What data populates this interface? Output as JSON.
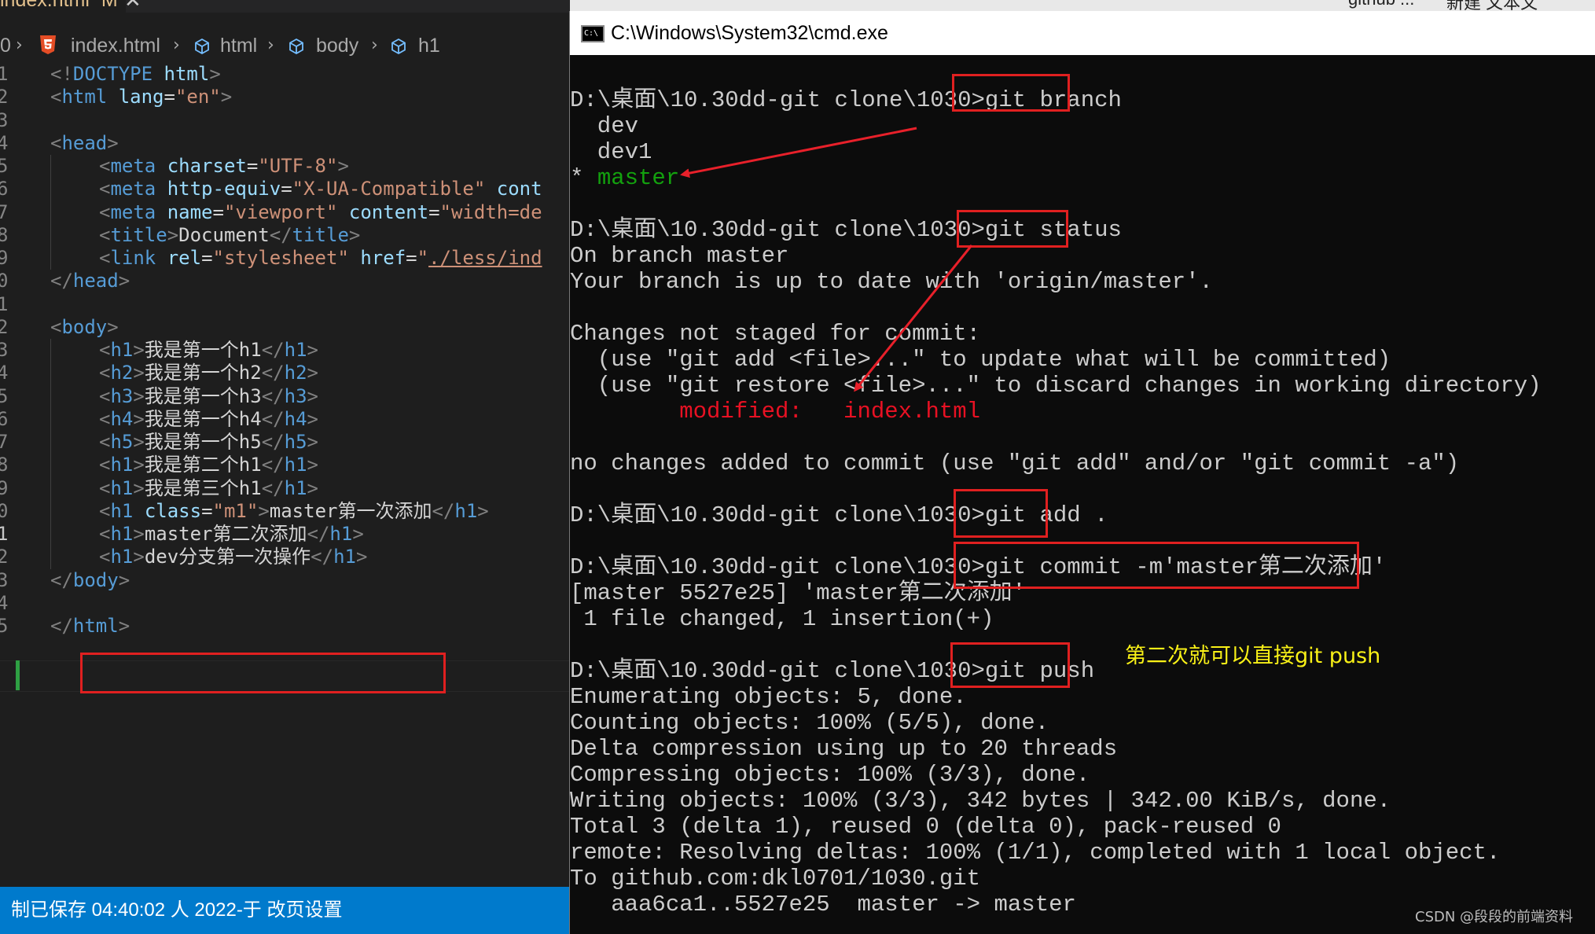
{
  "editor": {
    "tab": {
      "filename": "index.html",
      "status": "M",
      "close": "✕"
    },
    "breadcrumb": {
      "prefix": "0",
      "file": "index.html",
      "items": [
        "html",
        "body",
        "h1"
      ]
    },
    "lines": [
      {
        "n": "1",
        "tokens": [
          [
            "t",
            "<!"
          ],
          [
            "tg",
            "DOCTYPE"
          ],
          [
            "tx",
            " "
          ],
          [
            "at",
            "html"
          ],
          [
            "t",
            ">"
          ]
        ],
        "indent": 0
      },
      {
        "n": "2",
        "tokens": [
          [
            "t",
            "<"
          ],
          [
            "tg",
            "html"
          ],
          [
            "tx",
            " "
          ],
          [
            "at",
            "lang"
          ],
          [
            "tx",
            "="
          ],
          [
            "st",
            "\"en\""
          ],
          [
            "t",
            ">"
          ]
        ],
        "indent": 0
      },
      {
        "n": "3",
        "tokens": [],
        "indent": 0
      },
      {
        "n": "4",
        "tokens": [
          [
            "t",
            "<"
          ],
          [
            "tg",
            "head"
          ],
          [
            "t",
            ">"
          ]
        ],
        "indent": 0
      },
      {
        "n": "5",
        "tokens": [
          [
            "t",
            "<"
          ],
          [
            "tg",
            "meta"
          ],
          [
            "tx",
            " "
          ],
          [
            "at",
            "charset"
          ],
          [
            "tx",
            "="
          ],
          [
            "st",
            "\"UTF-8\""
          ],
          [
            "t",
            ">"
          ]
        ],
        "indent": 1
      },
      {
        "n": "6",
        "tokens": [
          [
            "t",
            "<"
          ],
          [
            "tg",
            "meta"
          ],
          [
            "tx",
            " "
          ],
          [
            "at",
            "http-equiv"
          ],
          [
            "tx",
            "="
          ],
          [
            "st",
            "\"X-UA-Compatible\""
          ],
          [
            "tx",
            " "
          ],
          [
            "at",
            "cont"
          ]
        ],
        "indent": 1
      },
      {
        "n": "7",
        "tokens": [
          [
            "t",
            "<"
          ],
          [
            "tg",
            "meta"
          ],
          [
            "tx",
            " "
          ],
          [
            "at",
            "name"
          ],
          [
            "tx",
            "="
          ],
          [
            "st",
            "\"viewport\""
          ],
          [
            "tx",
            " "
          ],
          [
            "at",
            "content"
          ],
          [
            "tx",
            "="
          ],
          [
            "st",
            "\"width=de"
          ]
        ],
        "indent": 1
      },
      {
        "n": "8",
        "tokens": [
          [
            "t",
            "<"
          ],
          [
            "tg",
            "title"
          ],
          [
            "t",
            ">"
          ],
          [
            "tx",
            "Document"
          ],
          [
            "t",
            "</"
          ],
          [
            "tg",
            "title"
          ],
          [
            "t",
            ">"
          ]
        ],
        "indent": 1
      },
      {
        "n": "9",
        "tokens": [
          [
            "t",
            "<"
          ],
          [
            "tg",
            "link"
          ],
          [
            "tx",
            " "
          ],
          [
            "at",
            "rel"
          ],
          [
            "tx",
            "="
          ],
          [
            "st",
            "\"stylesheet\""
          ],
          [
            "tx",
            " "
          ],
          [
            "at",
            "href"
          ],
          [
            "tx",
            "="
          ],
          [
            "st",
            "\""
          ],
          [
            "stl",
            "./less/ind"
          ]
        ],
        "indent": 1
      },
      {
        "n": "0",
        "tokens": [
          [
            "t",
            "</"
          ],
          [
            "tg",
            "head"
          ],
          [
            "t",
            ">"
          ]
        ],
        "indent": 0
      },
      {
        "n": "1",
        "tokens": [],
        "indent": 0
      },
      {
        "n": "2",
        "tokens": [
          [
            "t",
            "<"
          ],
          [
            "tg",
            "body"
          ],
          [
            "t",
            ">"
          ]
        ],
        "indent": 0
      },
      {
        "n": "3",
        "tokens": [
          [
            "t",
            "<"
          ],
          [
            "tg",
            "h1"
          ],
          [
            "t",
            ">"
          ],
          [
            "tx",
            "我是第一个h1"
          ],
          [
            "t",
            "</"
          ],
          [
            "tg",
            "h1"
          ],
          [
            "t",
            ">"
          ]
        ],
        "indent": 1
      },
      {
        "n": "4",
        "tokens": [
          [
            "t",
            "<"
          ],
          [
            "tg",
            "h2"
          ],
          [
            "t",
            ">"
          ],
          [
            "tx",
            "我是第一个h2"
          ],
          [
            "t",
            "</"
          ],
          [
            "tg",
            "h2"
          ],
          [
            "t",
            ">"
          ]
        ],
        "indent": 1
      },
      {
        "n": "5",
        "tokens": [
          [
            "t",
            "<"
          ],
          [
            "tg",
            "h3"
          ],
          [
            "t",
            ">"
          ],
          [
            "tx",
            "我是第一个h3"
          ],
          [
            "t",
            "</"
          ],
          [
            "tg",
            "h3"
          ],
          [
            "t",
            ">"
          ]
        ],
        "indent": 1
      },
      {
        "n": "6",
        "tokens": [
          [
            "t",
            "<"
          ],
          [
            "tg",
            "h4"
          ],
          [
            "t",
            ">"
          ],
          [
            "tx",
            "我是第一个h4"
          ],
          [
            "t",
            "</"
          ],
          [
            "tg",
            "h4"
          ],
          [
            "t",
            ">"
          ]
        ],
        "indent": 1
      },
      {
        "n": "7",
        "tokens": [
          [
            "t",
            "<"
          ],
          [
            "tg",
            "h5"
          ],
          [
            "t",
            ">"
          ],
          [
            "tx",
            "我是第一个h5"
          ],
          [
            "t",
            "</"
          ],
          [
            "tg",
            "h5"
          ],
          [
            "t",
            ">"
          ]
        ],
        "indent": 1
      },
      {
        "n": "8",
        "tokens": [
          [
            "t",
            "<"
          ],
          [
            "tg",
            "h1"
          ],
          [
            "t",
            ">"
          ],
          [
            "tx",
            "我是第二个h1"
          ],
          [
            "t",
            "</"
          ],
          [
            "tg",
            "h1"
          ],
          [
            "t",
            ">"
          ]
        ],
        "indent": 1
      },
      {
        "n": "9",
        "tokens": [
          [
            "t",
            "<"
          ],
          [
            "tg",
            "h1"
          ],
          [
            "t",
            ">"
          ],
          [
            "tx",
            "我是第三个h1"
          ],
          [
            "t",
            "</"
          ],
          [
            "tg",
            "h1"
          ],
          [
            "t",
            ">"
          ]
        ],
        "indent": 1
      },
      {
        "n": "0",
        "tokens": [
          [
            "t",
            "<"
          ],
          [
            "tg",
            "h1"
          ],
          [
            "tx",
            " "
          ],
          [
            "at",
            "class"
          ],
          [
            "tx",
            "="
          ],
          [
            "st",
            "\"m1\""
          ],
          [
            "t",
            ">"
          ],
          [
            "tx",
            "master第一次添加"
          ],
          [
            "t",
            "</"
          ],
          [
            "tg",
            "h1"
          ],
          [
            "t",
            ">"
          ]
        ],
        "indent": 1
      },
      {
        "n": "1",
        "tokens": [
          [
            "t",
            "<"
          ],
          [
            "tg",
            "h1"
          ],
          [
            "t",
            ">"
          ],
          [
            "tx",
            "master第二次添加"
          ],
          [
            "t",
            "</"
          ],
          [
            "tg",
            "h1"
          ],
          [
            "t",
            ">"
          ]
        ],
        "indent": 1,
        "active": true
      },
      {
        "n": "2",
        "tokens": [
          [
            "t",
            "<"
          ],
          [
            "tg",
            "h1"
          ],
          [
            "t",
            ">"
          ],
          [
            "tx",
            "dev分支第一次操作"
          ],
          [
            "t",
            "</"
          ],
          [
            "tg",
            "h1"
          ],
          [
            "t",
            ">"
          ]
        ],
        "indent": 1
      },
      {
        "n": "3",
        "tokens": [
          [
            "t",
            "</"
          ],
          [
            "tg",
            "body"
          ],
          [
            "t",
            ">"
          ]
        ],
        "indent": 0
      },
      {
        "n": "4",
        "tokens": [],
        "indent": 0
      },
      {
        "n": "5",
        "tokens": [
          [
            "t",
            "</"
          ],
          [
            "tg",
            "html"
          ],
          [
            "t",
            ">"
          ]
        ],
        "indent": 0
      }
    ],
    "statusbar": "制已保存 04:40:02     人 2022-于     改页设置"
  },
  "behind": {
    "text1": "github ...",
    "text2": "新建 文本文"
  },
  "cmd": {
    "title": "C:\\Windows\\System32\\cmd.exe",
    "icon_label": "C:\\",
    "lines": [
      {
        "text": "",
        "color": "default"
      },
      {
        "text": "D:\\桌面\\10.30dd-git clone\\1030>git branch",
        "color": "default"
      },
      {
        "text": "  dev",
        "color": "default"
      },
      {
        "text": "  dev1",
        "color": "default"
      },
      {
        "text": "* master",
        "color": "star-green"
      },
      {
        "text": "",
        "color": "default"
      },
      {
        "text": "D:\\桌面\\10.30dd-git clone\\1030>git status",
        "color": "default"
      },
      {
        "text": "On branch master",
        "color": "default"
      },
      {
        "text": "Your branch is up to date with 'origin/master'.",
        "color": "default"
      },
      {
        "text": "",
        "color": "default"
      },
      {
        "text": "Changes not staged for commit:",
        "color": "default"
      },
      {
        "text": "  (use \"git add <file>...\" to update what will be committed)",
        "color": "default"
      },
      {
        "text": "  (use \"git restore <file>...\" to discard changes in working directory)",
        "color": "default"
      },
      {
        "text": "        modified:   index.html",
        "color": "red"
      },
      {
        "text": "",
        "color": "default"
      },
      {
        "text": "no changes added to commit (use \"git add\" and/or \"git commit -a\")",
        "color": "default"
      },
      {
        "text": "",
        "color": "default"
      },
      {
        "text": "D:\\桌面\\10.30dd-git clone\\1030>git add .",
        "color": "default"
      },
      {
        "text": "",
        "color": "default"
      },
      {
        "text": "D:\\桌面\\10.30dd-git clone\\1030>git commit -m'master第二次添加'",
        "color": "default"
      },
      {
        "text": "[master 5527e25] 'master第二次添加'",
        "color": "default"
      },
      {
        "text": " 1 file changed, 1 insertion(+)",
        "color": "default"
      },
      {
        "text": "",
        "color": "default"
      },
      {
        "text": "D:\\桌面\\10.30dd-git clone\\1030>git push",
        "color": "default"
      },
      {
        "text": "Enumerating objects: 5, done.",
        "color": "default"
      },
      {
        "text": "Counting objects: 100% (5/5), done.",
        "color": "default"
      },
      {
        "text": "Delta compression using up to 20 threads",
        "color": "default"
      },
      {
        "text": "Compressing objects: 100% (3/3), done.",
        "color": "default"
      },
      {
        "text": "Writing objects: 100% (3/3), 342 bytes | 342.00 KiB/s, done.",
        "color": "default"
      },
      {
        "text": "Total 3 (delta 1), reused 0 (delta 0), pack-reused 0",
        "color": "default"
      },
      {
        "text": "remote: Resolving deltas: 100% (1/1), completed with 1 local object.",
        "color": "default"
      },
      {
        "text": "To github.com:dkl0701/1030.git",
        "color": "default"
      },
      {
        "text": "   aaa6ca1..5527e25  master -> master",
        "color": "default"
      }
    ],
    "note": "第二次就可以直接git push"
  },
  "watermark": "CSDN @段段的前端资料",
  "colors": {
    "accent_red": "#e02020",
    "arrow_red": "#e8202a",
    "note_yellow": "#f9f117",
    "cmd_green": "#13a10e",
    "cmd_red": "#e81123",
    "status_blue": "#007acc"
  }
}
